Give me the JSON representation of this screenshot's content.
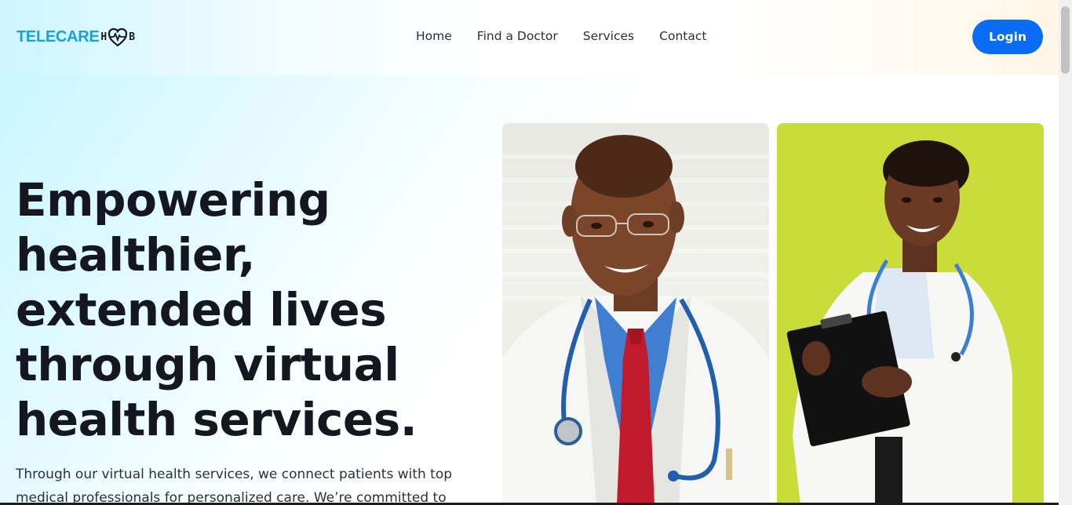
{
  "brand": {
    "name_part1": "TELECARE",
    "name_part2_left": "H",
    "name_part2_right": "B",
    "primary_color": "#1a9fe0",
    "icon": "heart-pulse-icon"
  },
  "nav": {
    "items": [
      {
        "label": "Home"
      },
      {
        "label": "Find a Doctor"
      },
      {
        "label": "Services"
      },
      {
        "label": "Contact"
      }
    ]
  },
  "login": {
    "label": "Login",
    "color": "#0a6cf4"
  },
  "hero": {
    "title_lines": [
      "Empowering",
      "healthier,",
      "extended lives",
      "through virtual",
      "health services."
    ],
    "description": "Through our virtual health services, we connect patients with top medical professionals for personalized care. We’re committed to"
  },
  "images": [
    {
      "name": "male-doctor-photo",
      "background": "#ecece6"
    },
    {
      "name": "female-doctor-photo",
      "background": "#c9dc3a"
    }
  ]
}
